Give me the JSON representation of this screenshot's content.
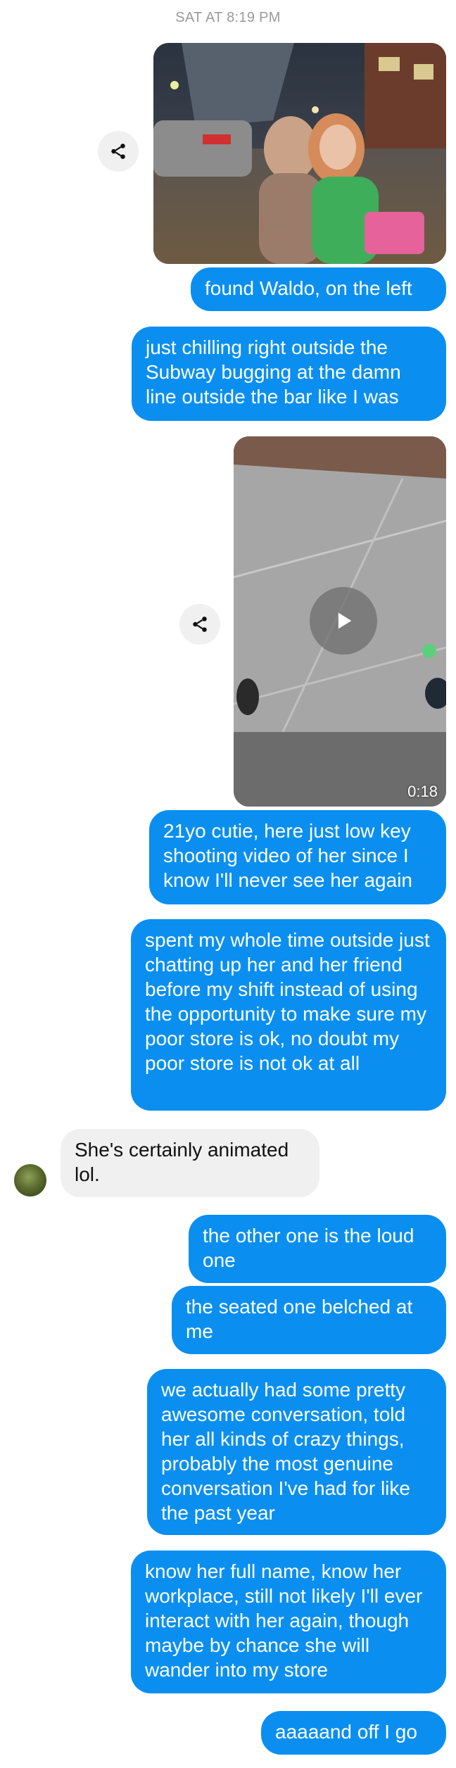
{
  "timestamp": "SAT AT 8:19 PM",
  "icons": {
    "share": "share-icon",
    "play": "play-icon",
    "avatar": "contact-avatar"
  },
  "video": {
    "duration": "0:18"
  },
  "messages": [
    {
      "from": "me",
      "text": "found Waldo, on the left"
    },
    {
      "from": "me",
      "text": "just chilling right outside the Subway bugging at the damn line outside the bar like I was"
    },
    {
      "from": "me",
      "text": "21yo cutie, here just low key shooting video of her since I know I'll never see her again"
    },
    {
      "from": "me",
      "text": "spent my whole time outside just chatting up her and her friend before my shift instead of using the opportunity to make sure my poor store is ok, no doubt my poor store is not ok at all"
    },
    {
      "from": "them",
      "text": "She's certainly animated lol."
    },
    {
      "from": "me",
      "text": "the other one is the loud one"
    },
    {
      "from": "me",
      "text": "the seated one belched at me"
    },
    {
      "from": "me",
      "text": "we actually had some pretty awesome conversation, told her all kinds of crazy things, probably the most genuine conversation I've had for like the past year"
    },
    {
      "from": "me",
      "text": "know her full name, know her workplace, still not likely I'll ever interact with her again, though maybe by chance she will wander into my store"
    },
    {
      "from": "me",
      "text": "aaaaand off I go"
    }
  ]
}
